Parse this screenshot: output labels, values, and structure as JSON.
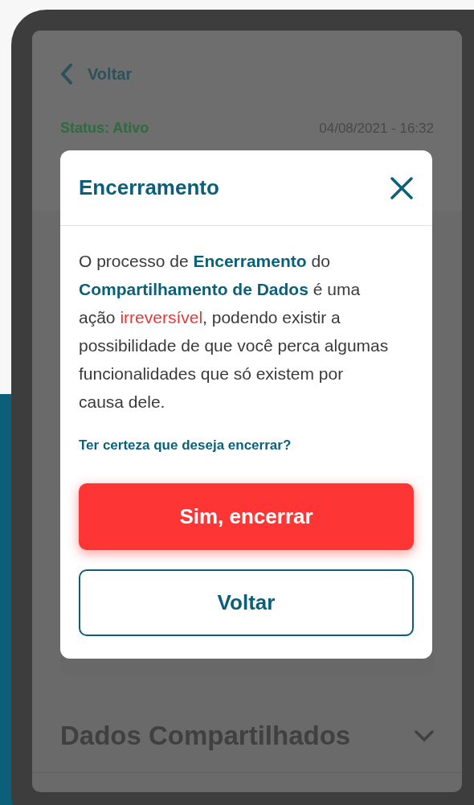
{
  "back": {
    "label": "Voltar"
  },
  "status": {
    "label": "Status: Ativo",
    "date": "04/08/2021 - 16:32"
  },
  "modal": {
    "title": "Encerramento",
    "message": [
      {
        "kind": "normal",
        "text": "O processo de "
      },
      {
        "kind": "bold",
        "text": "Encerramento"
      },
      {
        "kind": "normal",
        "text": " do "
      },
      {
        "kind": "bold",
        "text": "Compartilhamento de Dados"
      },
      {
        "kind": "normal",
        "text": " é uma ação "
      },
      {
        "kind": "alert",
        "text": "irreversível"
      },
      {
        "kind": "normal",
        "text": ", podendo existir a possibilidade de que você perca algumas funcionalidades que só existem por causa dele."
      }
    ],
    "question": "Ter certeza que deseja encerrar?",
    "buttons": [
      {
        "kind": "primary",
        "label": "Sim, encerrar"
      },
      {
        "kind": "secondary",
        "label": "Voltar"
      }
    ]
  },
  "section": {
    "title": "Dados Compartilhados",
    "expanded": false
  }
}
